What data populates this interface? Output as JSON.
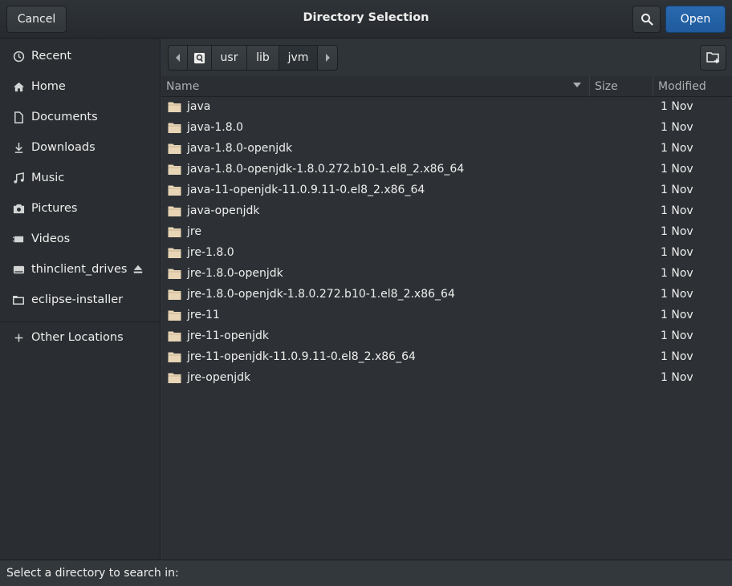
{
  "header": {
    "title": "Directory Selection",
    "cancel_label": "Cancel",
    "open_label": "Open",
    "search_icon": "search-icon"
  },
  "sidebar": {
    "items": [
      {
        "label": "Recent",
        "icon": "clock-icon"
      },
      {
        "label": "Home",
        "icon": "home-icon"
      },
      {
        "label": "Documents",
        "icon": "document-icon"
      },
      {
        "label": "Downloads",
        "icon": "download-icon"
      },
      {
        "label": "Music",
        "icon": "music-icon"
      },
      {
        "label": "Pictures",
        "icon": "camera-icon"
      },
      {
        "label": "Videos",
        "icon": "video-icon"
      },
      {
        "label": "thinclient_drives",
        "icon": "drive-icon",
        "eject": true
      },
      {
        "label": "eclipse-installer",
        "icon": "folder-icon"
      },
      {
        "label": "Other Locations",
        "icon": "plus-icon"
      }
    ]
  },
  "pathbar": {
    "segments": [
      "usr",
      "lib",
      "jvm"
    ],
    "root_icon": "disk-icon"
  },
  "columns": {
    "name": "Name",
    "size": "Size",
    "modified": "Modified"
  },
  "files": [
    {
      "name": "java",
      "modified": "1 Nov"
    },
    {
      "name": "java-1.8.0",
      "modified": "1 Nov"
    },
    {
      "name": "java-1.8.0-openjdk",
      "modified": "1 Nov"
    },
    {
      "name": "java-1.8.0-openjdk-1.8.0.272.b10-1.el8_2.x86_64",
      "modified": "1 Nov"
    },
    {
      "name": "java-11-openjdk-11.0.9.11-0.el8_2.x86_64",
      "modified": "1 Nov"
    },
    {
      "name": "java-openjdk",
      "modified": "1 Nov"
    },
    {
      "name": "jre",
      "modified": "1 Nov"
    },
    {
      "name": "jre-1.8.0",
      "modified": "1 Nov"
    },
    {
      "name": "jre-1.8.0-openjdk",
      "modified": "1 Nov"
    },
    {
      "name": "jre-1.8.0-openjdk-1.8.0.272.b10-1.el8_2.x86_64",
      "modified": "1 Nov"
    },
    {
      "name": "jre-11",
      "modified": "1 Nov"
    },
    {
      "name": "jre-11-openjdk",
      "modified": "1 Nov"
    },
    {
      "name": "jre-11-openjdk-11.0.9.11-0.el8_2.x86_64",
      "modified": "1 Nov"
    },
    {
      "name": "jre-openjdk",
      "modified": "1 Nov"
    }
  ],
  "status": {
    "text": "Select a directory to search in:"
  },
  "colors": {
    "accent": "#215d9c",
    "folder": "#e8d5b5"
  }
}
